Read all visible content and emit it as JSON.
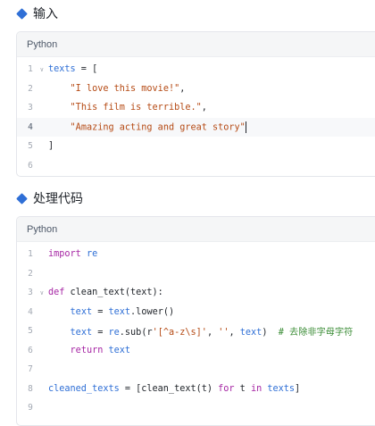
{
  "input_section": {
    "heading": "输入",
    "language": "Python",
    "lines": [
      {
        "num": "1",
        "fold": true,
        "indent": "",
        "tokens": [
          {
            "t": "var",
            "v": "texts"
          },
          {
            "t": "plain",
            "v": " = ["
          }
        ]
      },
      {
        "num": "2",
        "fold": false,
        "indent": "    ",
        "tokens": [
          {
            "t": "str",
            "v": "\"I love this movie!\""
          },
          {
            "t": "plain",
            "v": ","
          }
        ]
      },
      {
        "num": "3",
        "fold": false,
        "indent": "    ",
        "tokens": [
          {
            "t": "str",
            "v": "\"This film is terrible.\""
          },
          {
            "t": "plain",
            "v": ","
          }
        ]
      },
      {
        "num": "4",
        "fold": false,
        "indent": "    ",
        "active": true,
        "cursor": true,
        "tokens": [
          {
            "t": "str",
            "v": "\"Amazing acting and great story\""
          }
        ]
      },
      {
        "num": "5",
        "fold": false,
        "indent": "",
        "tokens": [
          {
            "t": "plain",
            "v": "]"
          }
        ]
      },
      {
        "num": "6",
        "fold": false,
        "indent": "",
        "tokens": []
      }
    ]
  },
  "process_section": {
    "heading": "处理代码",
    "language": "Python",
    "lines": [
      {
        "num": "1",
        "fold": false,
        "indent": "",
        "tokens": [
          {
            "t": "kw",
            "v": "import"
          },
          {
            "t": "plain",
            "v": " "
          },
          {
            "t": "var",
            "v": "re"
          }
        ]
      },
      {
        "num": "2",
        "fold": false,
        "indent": "",
        "tokens": []
      },
      {
        "num": "3",
        "fold": true,
        "indent": "",
        "tokens": [
          {
            "t": "kw",
            "v": "def"
          },
          {
            "t": "plain",
            "v": " clean_text(text):"
          }
        ]
      },
      {
        "num": "4",
        "fold": false,
        "indent": "    ",
        "tokens": [
          {
            "t": "var",
            "v": "text"
          },
          {
            "t": "plain",
            "v": " = "
          },
          {
            "t": "var",
            "v": "text"
          },
          {
            "t": "plain",
            "v": ".lower()"
          }
        ]
      },
      {
        "num": "5",
        "fold": false,
        "indent": "    ",
        "tokens": [
          {
            "t": "var",
            "v": "text"
          },
          {
            "t": "plain",
            "v": " = "
          },
          {
            "t": "var",
            "v": "re"
          },
          {
            "t": "plain",
            "v": ".sub(r"
          },
          {
            "t": "str",
            "v": "'[^a-z\\s]'"
          },
          {
            "t": "plain",
            "v": ", "
          },
          {
            "t": "str",
            "v": "''"
          },
          {
            "t": "plain",
            "v": ", "
          },
          {
            "t": "var",
            "v": "text"
          },
          {
            "t": "plain",
            "v": ")  "
          },
          {
            "t": "cm",
            "v": "# 去除非字母字符"
          }
        ]
      },
      {
        "num": "6",
        "fold": false,
        "indent": "    ",
        "tokens": [
          {
            "t": "kw",
            "v": "return"
          },
          {
            "t": "plain",
            "v": " "
          },
          {
            "t": "var",
            "v": "text"
          }
        ]
      },
      {
        "num": "7",
        "fold": false,
        "indent": "",
        "tokens": []
      },
      {
        "num": "8",
        "fold": false,
        "indent": "",
        "tokens": [
          {
            "t": "var",
            "v": "cleaned_texts"
          },
          {
            "t": "plain",
            "v": " = [clean_text(t) "
          },
          {
            "t": "kw",
            "v": "for"
          },
          {
            "t": "plain",
            "v": " t "
          },
          {
            "t": "kw",
            "v": "in"
          },
          {
            "t": "plain",
            "v": " "
          },
          {
            "t": "var",
            "v": "texts"
          },
          {
            "t": "plain",
            "v": "]"
          }
        ]
      },
      {
        "num": "9",
        "fold": false,
        "indent": "",
        "tokens": []
      }
    ]
  },
  "colors": {
    "accent": "#2f6fd6",
    "keyword": "#a626a4",
    "string": "#b54a14",
    "comment": "#3a8c35"
  },
  "icons": {
    "section_marker": "diamond-icon",
    "fold_marker": "chevron-down-icon"
  },
  "fold_glyph": "∨"
}
